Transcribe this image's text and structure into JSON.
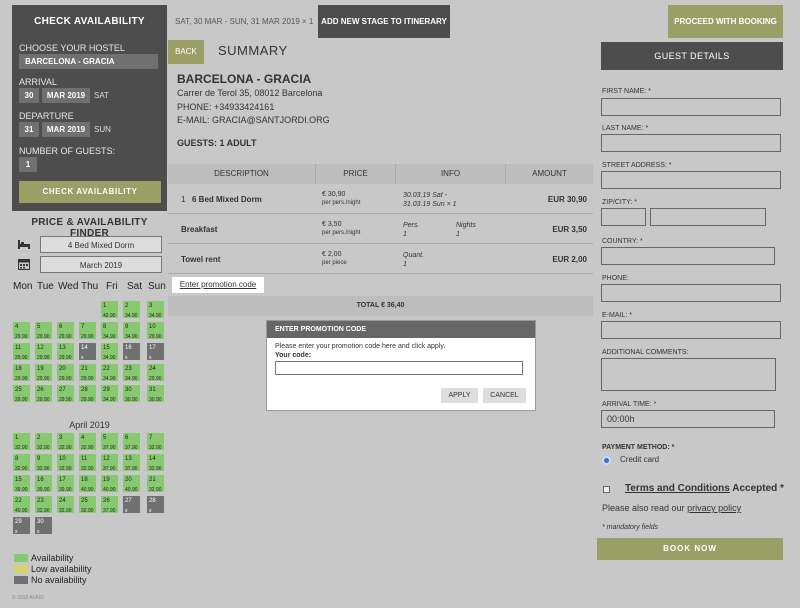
{
  "check": {
    "title": "CHECK AVAILABILITY",
    "hostel_label": "CHOOSE YOUR HOSTEL",
    "hostel_value": "BARCELONA - GRACIA",
    "arrival_label": "ARRIVAL",
    "arrival_day": "30",
    "arrival_month": "MAR 2019",
    "arrival_weekday": "SAT",
    "departure_label": "DEPARTURE",
    "departure_day": "31",
    "departure_month": "MAR 2019",
    "departure_weekday": "SUN",
    "guests_label": "NUMBER OF GUESTS:",
    "guests_value": "1",
    "button": "CHECK AVAILABILITY"
  },
  "finder": {
    "title": "PRICE & AVAILABILITY FINDER",
    "room_value": "4 Bed Mixed Dorm",
    "month_value": "March 2019",
    "weekdays": [
      "Mon",
      "Tue",
      "Wed",
      "Thu",
      "Fri",
      "Sat",
      "Sun"
    ]
  },
  "march": [
    {
      "d": "1",
      "p": "42.90",
      "s": "a"
    },
    {
      "d": "2",
      "p": "34.90",
      "s": "a"
    },
    {
      "d": "3",
      "p": "34.90",
      "s": "a"
    },
    {
      "d": "4",
      "p": "29.90",
      "s": "a"
    },
    {
      "d": "5",
      "p": "29.90",
      "s": "a"
    },
    {
      "d": "6",
      "p": "29.90",
      "s": "a"
    },
    {
      "d": "7",
      "p": "29.90",
      "s": "a"
    },
    {
      "d": "8",
      "p": "34.90",
      "s": "a"
    },
    {
      "d": "9",
      "p": "34.90",
      "s": "a"
    },
    {
      "d": "10",
      "p": "29.90",
      "s": "a"
    },
    {
      "d": "11",
      "p": "29.90",
      "s": "a"
    },
    {
      "d": "12",
      "p": "29.90",
      "s": "a"
    },
    {
      "d": "13",
      "p": "29.90",
      "s": "a"
    },
    {
      "d": "14",
      "p": "x",
      "s": "n"
    },
    {
      "d": "15",
      "p": "34.90",
      "s": "a"
    },
    {
      "d": "16",
      "p": "x",
      "s": "n"
    },
    {
      "d": "17",
      "p": "x",
      "s": "n"
    },
    {
      "d": "18",
      "p": "29.90",
      "s": "a"
    },
    {
      "d": "19",
      "p": "29.90",
      "s": "a"
    },
    {
      "d": "20",
      "p": "29.90",
      "s": "a"
    },
    {
      "d": "21",
      "p": "29.90",
      "s": "a"
    },
    {
      "d": "22",
      "p": "34.90",
      "s": "a"
    },
    {
      "d": "23",
      "p": "34.90",
      "s": "a"
    },
    {
      "d": "24",
      "p": "29.90",
      "s": "a"
    },
    {
      "d": "25",
      "p": "29.90",
      "s": "a"
    },
    {
      "d": "26",
      "p": "29.90",
      "s": "a"
    },
    {
      "d": "27",
      "p": "29.90",
      "s": "a"
    },
    {
      "d": "28",
      "p": "29.90",
      "s": "a"
    },
    {
      "d": "29",
      "p": "34.90",
      "s": "a"
    },
    {
      "d": "30",
      "p": "30.90",
      "s": "a"
    },
    {
      "d": "31",
      "p": "30.90",
      "s": "a"
    }
  ],
  "april_title": "April 2019",
  "april": [
    {
      "d": "1",
      "p": "32.90",
      "s": "a"
    },
    {
      "d": "2",
      "p": "32.90",
      "s": "a"
    },
    {
      "d": "3",
      "p": "32.90",
      "s": "a"
    },
    {
      "d": "4",
      "p": "32.90",
      "s": "a"
    },
    {
      "d": "5",
      "p": "37.90",
      "s": "a"
    },
    {
      "d": "6",
      "p": "37.90",
      "s": "a"
    },
    {
      "d": "7",
      "p": "32.90",
      "s": "a"
    },
    {
      "d": "8",
      "p": "32.90",
      "s": "a"
    },
    {
      "d": "9",
      "p": "32.90",
      "s": "a"
    },
    {
      "d": "10",
      "p": "32.90",
      "s": "a"
    },
    {
      "d": "11",
      "p": "32.90",
      "s": "a"
    },
    {
      "d": "12",
      "p": "37.90",
      "s": "a"
    },
    {
      "d": "13",
      "p": "37.90",
      "s": "a"
    },
    {
      "d": "14",
      "p": "32.90",
      "s": "a"
    },
    {
      "d": "15",
      "p": "39.90",
      "s": "a"
    },
    {
      "d": "16",
      "p": "39.90",
      "s": "a"
    },
    {
      "d": "17",
      "p": "39.90",
      "s": "a"
    },
    {
      "d": "18",
      "p": "40.90",
      "s": "a"
    },
    {
      "d": "19",
      "p": "40.90",
      "s": "a"
    },
    {
      "d": "20",
      "p": "40.90",
      "s": "a"
    },
    {
      "d": "21",
      "p": "32.90",
      "s": "a"
    },
    {
      "d": "22",
      "p": "40.90",
      "s": "a"
    },
    {
      "d": "23",
      "p": "32.90",
      "s": "a"
    },
    {
      "d": "24",
      "p": "32.90",
      "s": "a"
    },
    {
      "d": "25",
      "p": "32.90",
      "s": "a"
    },
    {
      "d": "26",
      "p": "37.90",
      "s": "a"
    },
    {
      "d": "27",
      "p": "x",
      "s": "n"
    },
    {
      "d": "28",
      "p": "x",
      "s": "n"
    },
    {
      "d": "29",
      "p": "x",
      "s": "n"
    },
    {
      "d": "30",
      "p": "x",
      "s": "n"
    }
  ],
  "legend": {
    "availability": "Availability",
    "low": "Low availability",
    "none": "No availability",
    "colors": {
      "availability": "#86c96f",
      "low": "#d6d36a",
      "none": "#707070"
    }
  },
  "copyright": "© 2018 AVAIO",
  "topbar": {
    "dates": "SAT, 30 MAR - SUN, 31 MAR 2019 × 1",
    "add_stage": "ADD NEW STAGE TO ITINERARY",
    "proceed": "PROCEED WITH BOOKING"
  },
  "summary": {
    "back": "BACK",
    "title": "SUMMARY",
    "hostel": "BARCELONA - GRACIA",
    "address": "Carrer de Terol 35, 08012 Barcelona",
    "phone": "PHONE:  +34933424161",
    "email": "E-MAIL:  GRACIA@SANTJORDI.ORG",
    "guests": "GUESTS: 1 ADULT",
    "headers": {
      "description": "DESCRIPTION",
      "price": "PRICE",
      "info": "INFO",
      "amount": "AMOUNT"
    },
    "rows": [
      {
        "num": "1",
        "desc": "6 Bed Mixed Dorm",
        "price": "€ 30,90",
        "price_sub": "per pers./night",
        "info": "30.03.19 Sat -",
        "info2": "31.03.19 Sun × 1",
        "amount": "EUR 30,90"
      },
      {
        "num": "",
        "desc": "Breakfast",
        "price": "€ 3,50",
        "price_sub": "per pers./night",
        "info": "Pers.",
        "info2": "1",
        "info_b": "Nights",
        "info_b2": "1",
        "amount": "EUR 3,50"
      },
      {
        "num": "",
        "desc": "Towel rent",
        "price": "€ 2,00",
        "price_sub": "per piece",
        "info": "Quant.",
        "info2": "1",
        "amount": "EUR 2,00"
      }
    ],
    "promo_link": "Enter promotion code",
    "total": "TOTAL € 36,40"
  },
  "modal": {
    "title": "ENTER PROMOTION CODE",
    "text": "Please enter your promotion code here and click apply.",
    "code_label": "Your code:",
    "code_value": "",
    "apply": "APPLY",
    "cancel": "CANCEL"
  },
  "guest": {
    "title": "GUEST DETAILS",
    "first_name": "FIRST NAME: *",
    "last_name": "LAST NAME: *",
    "street": "STREET ADDRESS: *",
    "zip_city": "ZIP/CITY: *",
    "country": "COUNTRY: *",
    "phone": "PHONE:",
    "email": "E-MAIL: *",
    "comments": "ADDITIONAL COMMENTS:",
    "arrival_time": "ARRIVAL TIME: *",
    "arrival_time_value": "00:00h",
    "payment_label": "PAYMENT METHOD: *",
    "payment_value": "Credit card",
    "terms_link": "Terms and Conditions",
    "terms_suffix": " Accepted *",
    "read_prefix": "Please also read our ",
    "privacy_link": "privacy policy",
    "mandatory": "* mandatory fields",
    "book": "BOOK NOW"
  }
}
